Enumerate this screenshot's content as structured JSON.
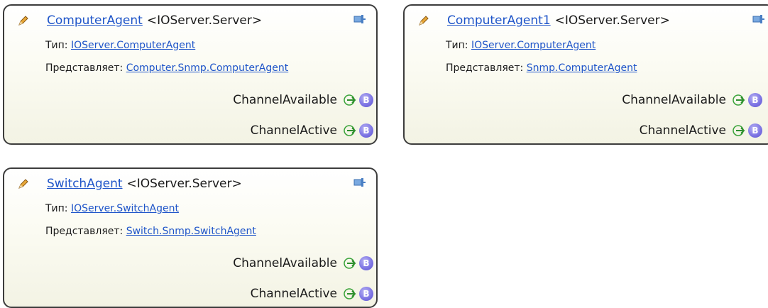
{
  "labels": {
    "type_label": "Тип:",
    "represents_label": "Представляет:"
  },
  "cards": [
    {
      "name": "ComputerAgent",
      "type": "<IOServer.Server>",
      "type_link": "IOServer.ComputerAgent",
      "represents_link": "Computer.Snmp.ComputerAgent",
      "events": [
        {
          "name": "ChannelAvailable",
          "badge": "B"
        },
        {
          "name": "ChannelActive",
          "badge": "B"
        }
      ]
    },
    {
      "name": "ComputerAgent1",
      "type": "<IOServer.Server>",
      "type_link": "IOServer.ComputerAgent",
      "represents_link": "Snmp.ComputerAgent",
      "events": [
        {
          "name": "ChannelAvailable",
          "badge": "B"
        },
        {
          "name": "ChannelActive",
          "badge": "B"
        }
      ]
    },
    {
      "name": "SwitchAgent",
      "type": "<IOServer.Server>",
      "type_link": "IOServer.SwitchAgent",
      "represents_link": "Switch.Snmp.SwitchAgent",
      "events": [
        {
          "name": "ChannelAvailable",
          "badge": "B"
        },
        {
          "name": "ChannelActive",
          "badge": "B"
        }
      ]
    }
  ],
  "icons": {
    "pencil": "pencil-icon",
    "pin": "pin-icon",
    "arrow": "arrow-right-icon",
    "badge": "b-badge-icon"
  }
}
